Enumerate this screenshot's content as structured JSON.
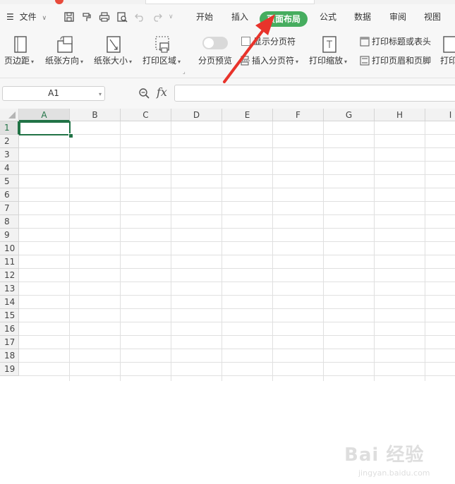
{
  "colors": {
    "accent": "#e84a3b",
    "tab_active": "#46ad5f",
    "cell_select": "#217346",
    "arrow": "#e8332b"
  },
  "menu": {
    "file_label": "文件",
    "tabs": [
      "开始",
      "插入",
      "页面布局",
      "公式",
      "数据",
      "审阅",
      "视图"
    ],
    "active_tab": "页面布局",
    "quick_access_icons": [
      "save-icon",
      "format-painter-icon",
      "print-icon",
      "print-preview-icon",
      "undo-icon",
      "redo-icon"
    ]
  },
  "ribbon": {
    "margins_label": "页边距",
    "orientation_label": "纸张方向",
    "size_label": "纸张大小",
    "print_area_label": "打印区域",
    "page_break_preview_label": "分页预览",
    "show_page_break_label": "显示分页符",
    "insert_page_break_label": "插入分页符",
    "print_scale_label": "打印缩放",
    "print_titles_label": "打印标题或表头",
    "print_header_footer_label": "打印页眉和页脚",
    "more_label": "打印"
  },
  "formula_bar": {
    "name_box": "A1",
    "fx_label": "fx",
    "formula_value": ""
  },
  "grid": {
    "columns": [
      "A",
      "B",
      "C",
      "D",
      "E",
      "F",
      "G",
      "H",
      "I"
    ],
    "rows": [
      "1",
      "2",
      "3",
      "4",
      "5",
      "6",
      "7",
      "8",
      "9",
      "10",
      "11",
      "12",
      "13",
      "14",
      "15",
      "16",
      "17",
      "18",
      "19"
    ],
    "active_cell": "A1"
  },
  "watermark": {
    "text": "Bai 经验",
    "sub": "jingyan.baidu.com"
  }
}
